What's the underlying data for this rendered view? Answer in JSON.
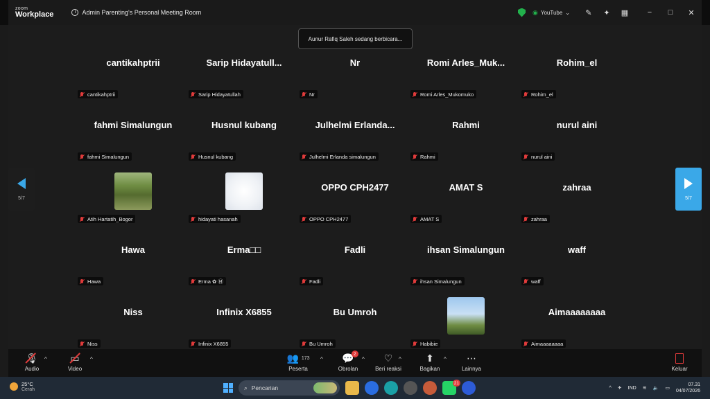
{
  "titlebar": {
    "brand_small": "zoom",
    "brand_big": "Workplace",
    "meeting_title": "Admin Parenting's Personal Meeting Room",
    "stream_label": "YouTube",
    "icons": [
      "shield-icon",
      "broadcast-icon",
      "chevron-down-icon",
      "whiteboard-icon",
      "sparkle-icon",
      "grid-icon"
    ],
    "window_controls": [
      "−",
      "□",
      "✕"
    ]
  },
  "toast": "Aunur Rafiq Saleh sedang berbicara...",
  "gallery": {
    "page_indicator": "5/7",
    "tiles": [
      {
        "display": "cantikahptrii",
        "label": "cantikahptrii"
      },
      {
        "display": "Sarip  Hidayatull...",
        "label": "Sarip Hidayatullah"
      },
      {
        "display": "Nr",
        "label": "Nr"
      },
      {
        "display": "Romi  Arles_Muk...",
        "label": "Romi Arles_Mukomuko"
      },
      {
        "display": "Rohim_el",
        "label": "Rohim_el"
      },
      {
        "display": "fahmi Simalungun",
        "label": "fahmi Simalungun"
      },
      {
        "display": "Husnul kubang",
        "label": "Husnul kubang"
      },
      {
        "display": "Julhelmi  Erlanda...",
        "label": "Julhelmi Erlanda simalungun"
      },
      {
        "display": "Rahmi",
        "label": "Rahmi"
      },
      {
        "display": "nurul aini",
        "label": "nurul aini"
      },
      {
        "display": "",
        "label": "Atih Hartatih_Bogor"
      },
      {
        "display": "",
        "label": "hidayati hasanah"
      },
      {
        "display": "OPPO CPH2477",
        "label": "OPPO CPH2477"
      },
      {
        "display": "AMAT S",
        "label": "AMAT S"
      },
      {
        "display": "zahraa",
        "label": "zahraa"
      },
      {
        "display": "Hawa",
        "label": "Hawa"
      },
      {
        "display": "Erma□□",
        "label": "Erma ✿ Ⓜ"
      },
      {
        "display": "Fadli",
        "label": "Fadli"
      },
      {
        "display": "ihsan Simalungun",
        "label": "ihsan Simalungun"
      },
      {
        "display": "waff",
        "label": "waff"
      },
      {
        "display": "Niss",
        "label": "Niss"
      },
      {
        "display": "Infinix X6855",
        "label": "Infinix X6855"
      },
      {
        "display": "Bu Umroh",
        "label": "Bu Umroh"
      },
      {
        "display": "",
        "label": "Habibie"
      },
      {
        "display": "Aimaaaaaaaa",
        "label": "Aimaaaaaaaa"
      }
    ]
  },
  "toolbar": {
    "audio": "Audio",
    "video": "Video",
    "participants": "Peserta",
    "participants_count": "173",
    "chat": "Obrolan",
    "chat_badge": "2",
    "reactions": "Beri reaksi",
    "share": "Bagikan",
    "more": "Lainnya",
    "leave": "Keluar"
  },
  "taskbar": {
    "temperature": "25°C",
    "weather": "Cerah",
    "search_placeholder": "Pencarian",
    "notification_badge": "21",
    "language": "IND",
    "time": "07.31",
    "date": "04/07/2026"
  },
  "colors": {
    "accent": "#3aa8e8",
    "muted_red": "#e03b3b",
    "secure_green": "#22b14c"
  }
}
